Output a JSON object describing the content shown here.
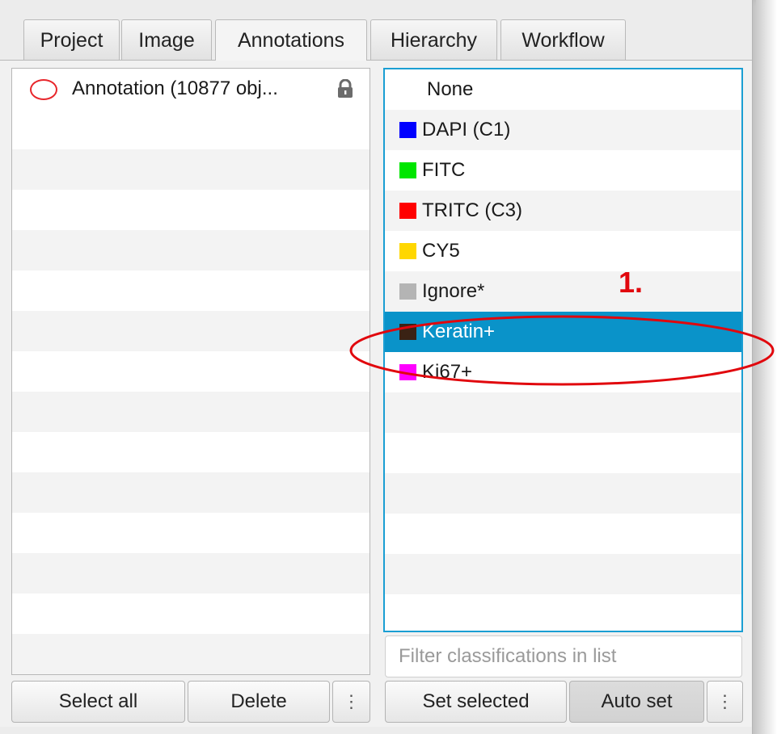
{
  "tabs": [
    {
      "label": "Project"
    },
    {
      "label": "Image"
    },
    {
      "label": "Annotations",
      "active": true
    },
    {
      "label": "Hierarchy"
    },
    {
      "label": "Workflow"
    }
  ],
  "annotations_list": {
    "items": [
      {
        "label": "Annotation (10877 obj...",
        "shape_color": "#e8262b",
        "icon": "lock-icon"
      }
    ]
  },
  "classifications": {
    "items": [
      {
        "label": "None",
        "color": null
      },
      {
        "label": "DAPI (C1)",
        "color": "#0000ff"
      },
      {
        "label": "FITC",
        "color": "#00e600"
      },
      {
        "label": "TRITC (C3)",
        "color": "#ff0000"
      },
      {
        "label": "CY5",
        "color": "#ffd700"
      },
      {
        "label": "Ignore*",
        "color": "#b4b4b4"
      },
      {
        "label": "Keratin+",
        "color": "#3a2214",
        "selected": true
      },
      {
        "label": "Ki67+",
        "color": "#ff00ff"
      }
    ],
    "filter_placeholder": "Filter classifications in list"
  },
  "left_buttons": {
    "select_all": "Select all",
    "delete": "Delete",
    "more": "⋮"
  },
  "right_buttons": {
    "set_selected": "Set selected",
    "auto_set": "Auto set",
    "more": "⋮"
  },
  "callout": {
    "label": "1.",
    "color": "#e1070d"
  },
  "colors": {
    "accent": "#0a93c9",
    "focus_border": "#1a9ed3"
  }
}
